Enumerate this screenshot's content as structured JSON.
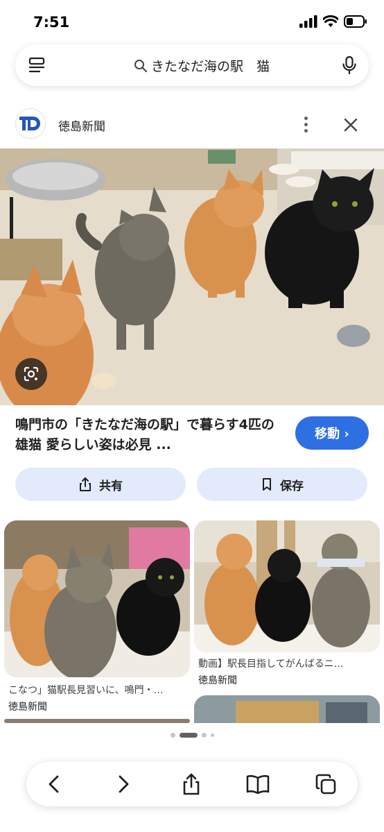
{
  "status": {
    "time": "7:51"
  },
  "search": {
    "query": "きたなだ海の駅　猫"
  },
  "source": {
    "name": "徳島新聞",
    "logo_text": "TD"
  },
  "result": {
    "title": "鳴門市の「きたなだ海の駅」で暮らす4匹の雄猫 愛らしい姿は必見 ...",
    "visit_label": "移動 ›"
  },
  "actions": {
    "share_label": "共有",
    "save_label": "保存"
  },
  "related": [
    {
      "caption": "こなつ」猫駅長見習いに、鳴門・…",
      "source": "徳島新聞"
    },
    {
      "caption": "動画】駅長目指してがんばるニ…",
      "source": "徳島新聞"
    }
  ],
  "colors": {
    "accent": "#2f6fe4",
    "chip_bg": "#e3eafb"
  },
  "icons": [
    "signal-icon",
    "wifi-icon",
    "battery-icon",
    "menu-icon",
    "search-icon",
    "mic-icon",
    "more-icon",
    "close-icon",
    "lens-icon",
    "share-icon",
    "bookmark-icon",
    "back-icon",
    "forward-icon",
    "share-icon",
    "bookmarks-icon",
    "tabs-icon"
  ]
}
